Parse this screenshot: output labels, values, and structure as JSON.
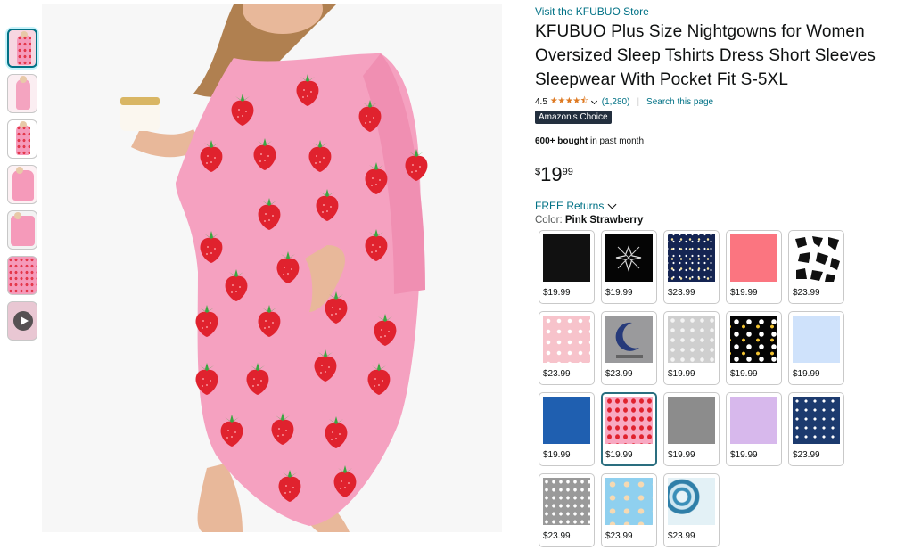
{
  "thumbnails": [
    "thumbnail-1",
    "thumbnail-2",
    "thumbnail-3",
    "thumbnail-4",
    "thumbnail-5",
    "thumbnail-6",
    "video-thumbnail"
  ],
  "product": {
    "store_link": "Visit the KFUBUO Store",
    "title": "KFUBUO Plus Size Nightgowns for Women Oversized Sleep Tshirts Dress Short Sleeves Sleepwear With Pocket Fit S-5XL",
    "rating": "4.5",
    "stars": "★★★★⯪",
    "rating_count": "(1,280)",
    "separator": "|",
    "search_page": "Search this page",
    "badge": "Amazon's Choice",
    "bought_bold": "600+ bought",
    "bought_rest": " in past month",
    "price_symbol": "$",
    "price_whole": "19",
    "price_fraction": "99",
    "returns": "FREE Returns",
    "color_label": "Color: ",
    "color_value": "Pink Strawberry"
  },
  "swatches": [
    {
      "price": "$19.99",
      "pattern": "black"
    },
    {
      "price": "$19.99",
      "pattern": "diamond"
    },
    {
      "price": "$23.99",
      "pattern": "galaxy"
    },
    {
      "price": "$19.99",
      "pattern": "coral"
    },
    {
      "price": "$23.99",
      "pattern": "cow"
    },
    {
      "price": "$23.99",
      "pattern": "pink-cats"
    },
    {
      "price": "$23.99",
      "pattern": "moon"
    },
    {
      "price": "$19.99",
      "pattern": "grey-pattern"
    },
    {
      "price": "$19.99",
      "pattern": "daisy"
    },
    {
      "price": "$19.99",
      "pattern": "light-blue"
    },
    {
      "price": "$19.99",
      "pattern": "royal-blue"
    },
    {
      "price": "$19.99",
      "pattern": "strawberry",
      "selected": true
    },
    {
      "price": "$19.99",
      "pattern": "grey"
    },
    {
      "price": "$19.99",
      "pattern": "lavender"
    },
    {
      "price": "$23.99",
      "pattern": "navy-hearts"
    },
    {
      "price": "$23.99",
      "pattern": "grey-stars"
    },
    {
      "price": "$23.99",
      "pattern": "sky-donut"
    },
    {
      "price": "$23.99",
      "pattern": "blue-tiedye"
    }
  ],
  "colors": {
    "link": "#007185",
    "badge_bg": "#232f3e",
    "star": "#de7921",
    "selected_border": "#2a6e7f"
  }
}
